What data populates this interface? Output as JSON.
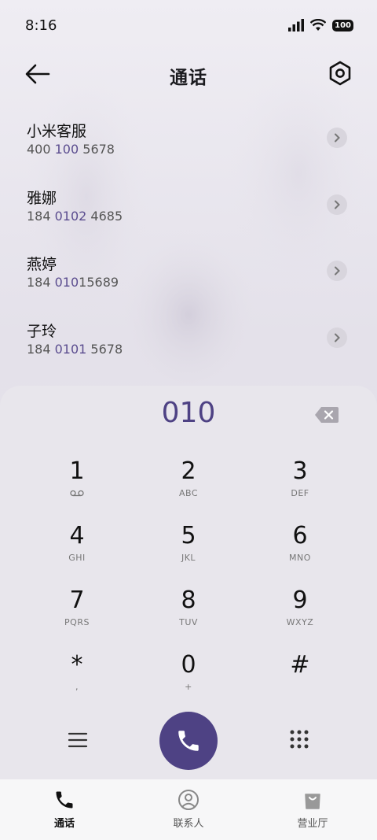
{
  "status_bar": {
    "time": "8:16",
    "battery": "100"
  },
  "header": {
    "title": "通话"
  },
  "contacts": [
    {
      "name": "小米客服",
      "num_pre": "400 ",
      "num_hl": "100",
      "num_post": " 5678"
    },
    {
      "name": "雅娜",
      "num_pre": "184 ",
      "num_hl": "0102",
      "num_post": " 4685"
    },
    {
      "name": "燕婷",
      "num_pre": "184 ",
      "num_hl": "010",
      "num_post": "15689"
    },
    {
      "name": "子玲",
      "num_pre": "184 ",
      "num_hl": "0101",
      "num_post": " 5678"
    }
  ],
  "dialer": {
    "typed_number": "010",
    "keys": [
      {
        "digit": "1",
        "sub": "",
        "icon": "voicemail-icon"
      },
      {
        "digit": "2",
        "sub": "ABC"
      },
      {
        "digit": "3",
        "sub": "DEF"
      },
      {
        "digit": "4",
        "sub": "GHI"
      },
      {
        "digit": "5",
        "sub": "JKL"
      },
      {
        "digit": "6",
        "sub": "MNO"
      },
      {
        "digit": "7",
        "sub": "PQRS"
      },
      {
        "digit": "8",
        "sub": "TUV"
      },
      {
        "digit": "9",
        "sub": "WXYZ"
      },
      {
        "digit": "*",
        "sub": ","
      },
      {
        "digit": "0",
        "sub": "+"
      },
      {
        "digit": "#",
        "sub": ""
      }
    ]
  },
  "bottom_nav": [
    {
      "label": "通话",
      "icon": "phone-icon",
      "active": true
    },
    {
      "label": "联系人",
      "icon": "person-icon",
      "active": false
    },
    {
      "label": "营业厅",
      "icon": "shopping-bag-icon",
      "active": false
    }
  ],
  "colors": {
    "accent": "#4e4284",
    "highlight": "#5b4d8f"
  }
}
